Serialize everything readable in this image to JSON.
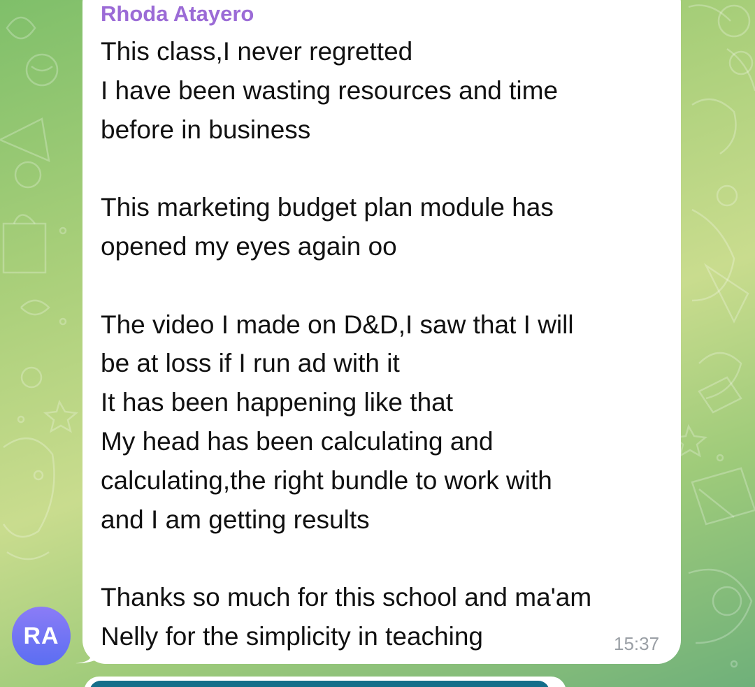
{
  "chat": {
    "message": {
      "sender_name": "Rhoda Atayero",
      "lines": [
        "This class,I never regretted",
        "I have been wasting resources and time",
        "before in business",
        "",
        "This marketing budget plan module has",
        "opened my eyes again oo",
        "",
        "The video I made on D&D,I saw that I will",
        "be at loss if I run ad with it",
        "It has been happening like that",
        "My head has been calculating and",
        "calculating,the right bundle to work with",
        "and I am getting results",
        "",
        "Thanks so much for this school and ma'am",
        "Nelly for the simplicity in teaching"
      ],
      "time": "15:37",
      "sender_color": "#9b6bd6"
    },
    "avatar": {
      "initials": "RA"
    }
  }
}
